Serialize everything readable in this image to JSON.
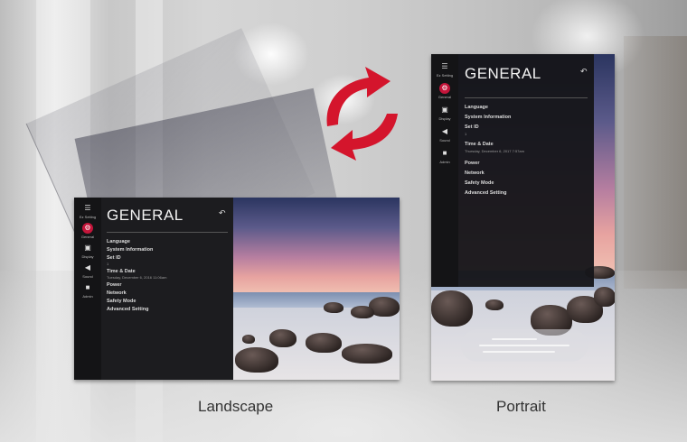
{
  "landscape": {
    "rail": [
      {
        "icon": "ez-setting-icon",
        "glyph": "☰",
        "label": "Ez Setting",
        "active": false
      },
      {
        "icon": "general-icon",
        "glyph": "⚙",
        "label": "General",
        "active": true
      },
      {
        "icon": "display-icon",
        "glyph": "▣",
        "label": "Display",
        "active": false
      },
      {
        "icon": "sound-icon",
        "glyph": "◀",
        "label": "Sound",
        "active": false
      },
      {
        "icon": "admin-icon",
        "glyph": "■",
        "label": "Admin",
        "active": false
      }
    ],
    "title": "GENERAL",
    "back_glyph": "↶",
    "items": [
      "Language",
      "System Information",
      "Set ID",
      "Time & Date",
      "Power",
      "Network",
      "Safety Mode",
      "Advanced Setting"
    ],
    "set_id_value": "1",
    "time_date_value": "Tuesday, December 6, 2016 11:06am"
  },
  "portrait": {
    "rail": [
      {
        "icon": "ez-setting-icon",
        "glyph": "☰",
        "label": "Ez Setting",
        "active": false
      },
      {
        "icon": "general-icon",
        "glyph": "⚙",
        "label": "General",
        "active": true
      },
      {
        "icon": "display-icon",
        "glyph": "▣",
        "label": "Display",
        "active": false
      },
      {
        "icon": "sound-icon",
        "glyph": "◀",
        "label": "Sound",
        "active": false
      },
      {
        "icon": "admin-icon",
        "glyph": "■",
        "label": "Admin",
        "active": false
      }
    ],
    "title": "GENERAL",
    "back_glyph": "↶",
    "items": [
      "Language",
      "System Information",
      "Set ID",
      "Time & Date",
      "Power",
      "Network",
      "Safety Mode",
      "Advanced Setting"
    ],
    "set_id_value": "1",
    "time_date_value": "Thursday, December 6, 2017 7:57am"
  },
  "captions": {
    "landscape": "Landscape",
    "portrait": "Portrait"
  },
  "colors": {
    "accent": "#c4153a",
    "arrow": "#d4152c"
  }
}
